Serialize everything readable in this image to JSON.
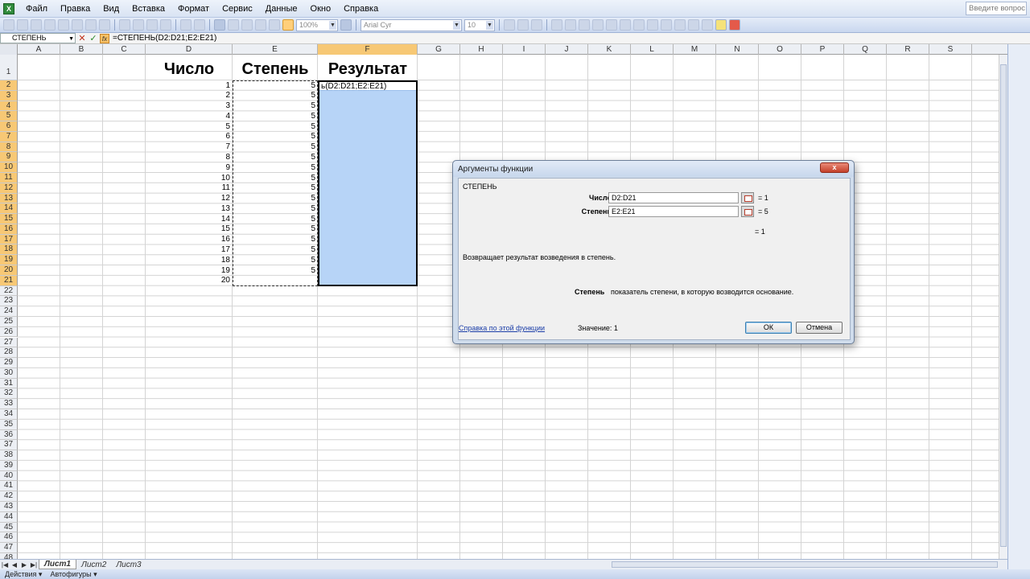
{
  "menu": {
    "items": [
      "Файл",
      "Правка",
      "Вид",
      "Вставка",
      "Формат",
      "Сервис",
      "Данные",
      "Окно",
      "Справка"
    ],
    "help_placeholder": "Введите вопрос"
  },
  "toolbar": {
    "zoom": "100%",
    "font_name": "Arial Cyr",
    "font_size": "10"
  },
  "formula_bar": {
    "name_box": "СТЕПЕНЬ",
    "cancel_symbol": "✕",
    "enter_symbol": "✓",
    "fx_symbol": "fx",
    "formula": "=СТЕПЕНЬ(D2:D21;E2:E21)"
  },
  "grid": {
    "columns": [
      "A",
      "B",
      "C",
      "D",
      "E",
      "F",
      "G",
      "H",
      "I",
      "J",
      "K",
      "L",
      "M",
      "N",
      "O",
      "P",
      "Q",
      "R",
      "S"
    ],
    "selected_column": "F",
    "row_count": 48,
    "headers": {
      "D": "Число",
      "E": "Степень",
      "F": "Результат"
    },
    "numbers": [
      1,
      2,
      3,
      4,
      5,
      6,
      7,
      8,
      9,
      10,
      11,
      12,
      13,
      14,
      15,
      16,
      17,
      18,
      19,
      20
    ],
    "powers": [
      5,
      5,
      5,
      5,
      5,
      5,
      5,
      5,
      5,
      5,
      5,
      5,
      5,
      5,
      5,
      5,
      5,
      5,
      5
    ],
    "active_cell_text": "ь(D2:D21;E2:E21)"
  },
  "sheets": {
    "tabs": [
      "Лист1",
      "Лист2",
      "Лист3"
    ],
    "active": "Лист1"
  },
  "drawing_bar": {
    "actions": "Действия ▾",
    "autoshapes": "Автофигуры ▾"
  },
  "dialog": {
    "title": "Аргументы функции",
    "close_symbol": "x",
    "function_name": "СТЕПЕНЬ",
    "args": [
      {
        "label": "Число",
        "value": "D2:D21",
        "result": "= 1"
      },
      {
        "label": "Степень",
        "value": "E2:E21",
        "result": "= 5"
      }
    ],
    "formula_result": "= 1",
    "description": "Возвращает результат возведения в степень.",
    "arg_desc_name": "Степень",
    "arg_desc_text": "показатель степени, в которую возводится основание.",
    "help_link": "Справка по этой функции",
    "value_text": "Значение: 1",
    "ok_label": "ОК",
    "cancel_label": "Отмена"
  }
}
